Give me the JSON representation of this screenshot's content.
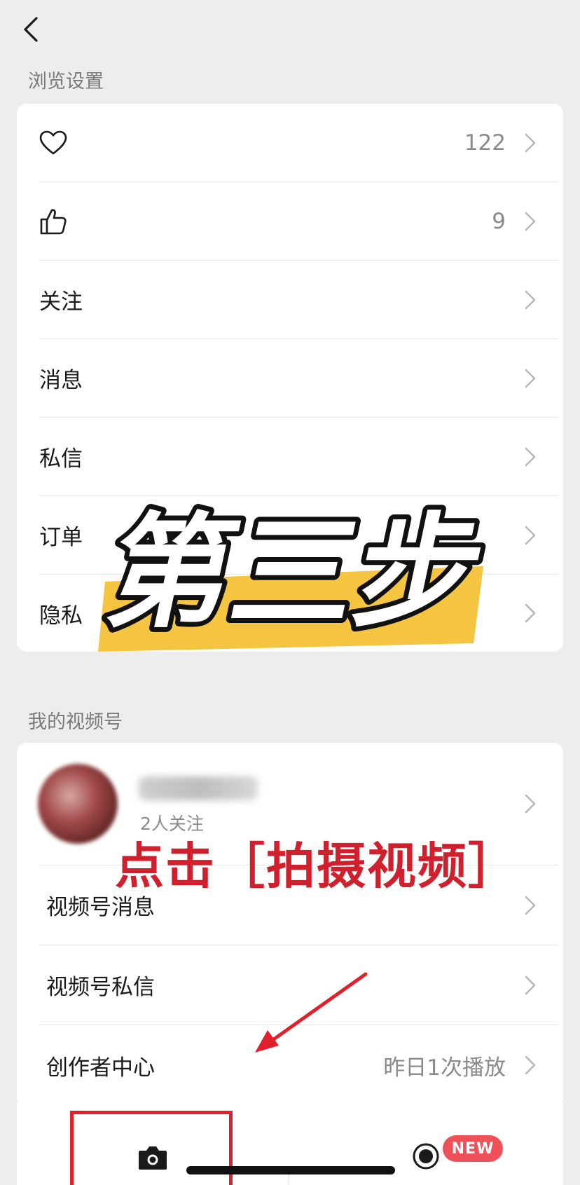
{
  "nav": {
    "back_icon": "chevron-left-icon"
  },
  "browse_settings": {
    "title": "浏览设置",
    "rows": [
      {
        "icon": "heart-icon",
        "label": "",
        "value": "122"
      },
      {
        "icon": "thumbs-up-icon",
        "label": "",
        "value": "9"
      },
      {
        "label": "关注",
        "value": ""
      },
      {
        "label": "消息",
        "value": ""
      },
      {
        "label": "私信",
        "value": ""
      },
      {
        "label": "订单",
        "value": ""
      },
      {
        "label": "隐私",
        "value": ""
      }
    ]
  },
  "overlay": {
    "step_text": "第三步",
    "highlight_color": "#f5c542",
    "instruction": "点击［拍摄视频］",
    "instruction_color": "#d0202e"
  },
  "channels": {
    "title": "我的视频号",
    "profile": {
      "followers": "2人关注"
    },
    "rows": [
      {
        "label": "视频号消息",
        "value": ""
      },
      {
        "label": "视频号私信",
        "value": ""
      },
      {
        "label": "创作者中心",
        "value": "昨日1次播放"
      }
    ]
  },
  "tabbar": {
    "camera_icon": "camera-icon",
    "record_icon": "record-icon",
    "badge": "NEW"
  }
}
